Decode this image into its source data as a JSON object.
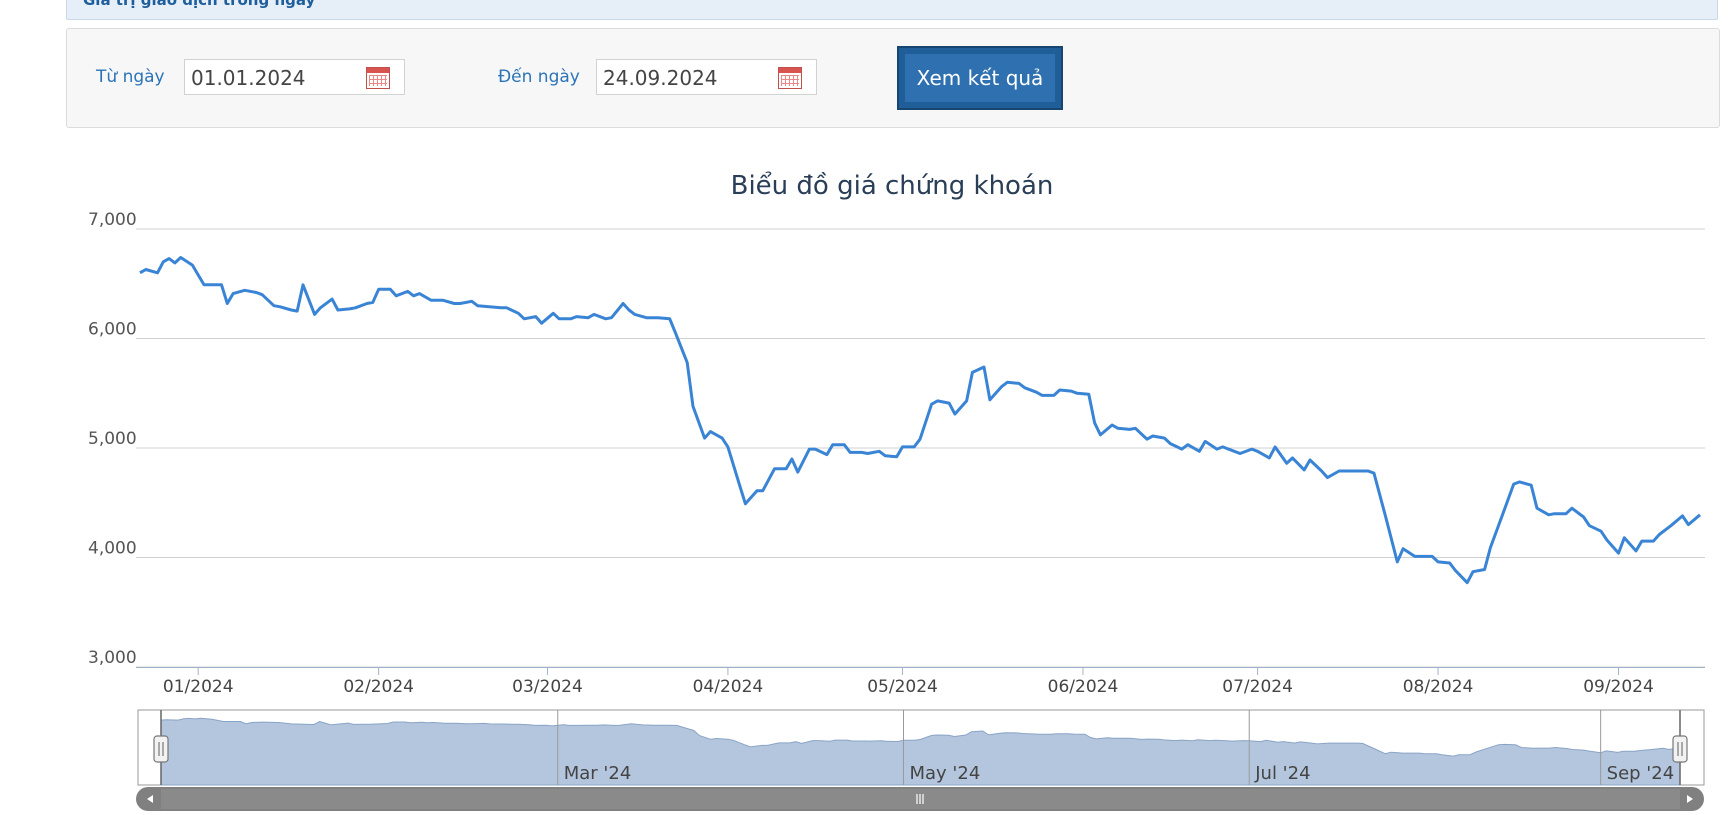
{
  "header": {
    "title": "Giá trị giao dịch trong ngày"
  },
  "filter": {
    "from_label": "Từ ngày",
    "from_value": "01.01.2024",
    "to_label": "Đến ngày",
    "to_value": "24.09.2024",
    "submit_label": "Xem kết quả"
  },
  "colors": {
    "accent": "#2f71b0",
    "line": "#3a84d6",
    "navigator_fill": "#b4c6dd",
    "scrollbar": "#808080"
  },
  "chart_data": {
    "type": "line",
    "title": "Biểu đồ giá chứng khoán",
    "xlabel": "",
    "ylabel": "",
    "ylim": [
      3000,
      7000
    ],
    "yticks": [
      3000,
      4000,
      5000,
      6000,
      7000
    ],
    "ytick_labels": [
      "3,000",
      "4,000",
      "5,000",
      "6,000",
      "7,000"
    ],
    "xticks": [
      {
        "x": "2024-01-01",
        "label": "01/2024"
      },
      {
        "x": "2024-02-01",
        "label": "02/2024"
      },
      {
        "x": "2024-03-01",
        "label": "03/2024"
      },
      {
        "x": "2024-04-01",
        "label": "04/2024"
      },
      {
        "x": "2024-05-01",
        "label": "05/2024"
      },
      {
        "x": "2024-06-01",
        "label": "06/2024"
      },
      {
        "x": "2024-07-01",
        "label": "07/2024"
      },
      {
        "x": "2024-08-01",
        "label": "08/2024"
      },
      {
        "x": "2024-09-01",
        "label": "09/2024"
      }
    ],
    "grid": true,
    "series": [
      {
        "points": [
          [
            "2023-12-22",
            6600
          ],
          [
            "2023-12-23",
            6630
          ],
          [
            "2023-12-25",
            6600
          ],
          [
            "2023-12-26",
            6700
          ],
          [
            "2023-12-27",
            6730
          ],
          [
            "2023-12-28",
            6690
          ],
          [
            "2023-12-29",
            6740
          ],
          [
            "2023-12-31",
            6670
          ],
          [
            "2024-01-02",
            6490
          ],
          [
            "2024-01-03",
            6490
          ],
          [
            "2024-01-05",
            6490
          ],
          [
            "2024-01-06",
            6320
          ],
          [
            "2024-01-07",
            6410
          ],
          [
            "2024-01-09",
            6440
          ],
          [
            "2024-01-11",
            6420
          ],
          [
            "2024-01-12",
            6400
          ],
          [
            "2024-01-14",
            6300
          ],
          [
            "2024-01-15",
            6290
          ],
          [
            "2024-01-17",
            6260
          ],
          [
            "2024-01-18",
            6250
          ],
          [
            "2024-01-19",
            6490
          ],
          [
            "2024-01-21",
            6220
          ],
          [
            "2024-01-22",
            6280
          ],
          [
            "2024-01-24",
            6360
          ],
          [
            "2024-01-25",
            6260
          ],
          [
            "2024-01-27",
            6270
          ],
          [
            "2024-01-28",
            6280
          ],
          [
            "2024-01-30",
            6320
          ],
          [
            "2024-01-31",
            6330
          ],
          [
            "2024-02-01",
            6450
          ],
          [
            "2024-02-03",
            6450
          ],
          [
            "2024-02-04",
            6390
          ],
          [
            "2024-02-06",
            6430
          ],
          [
            "2024-02-07",
            6390
          ],
          [
            "2024-02-08",
            6410
          ],
          [
            "2024-02-10",
            6350
          ],
          [
            "2024-02-12",
            6350
          ],
          [
            "2024-02-14",
            6320
          ],
          [
            "2024-02-15",
            6320
          ],
          [
            "2024-02-17",
            6340
          ],
          [
            "2024-02-18",
            6300
          ],
          [
            "2024-02-20",
            6290
          ],
          [
            "2024-02-22",
            6280
          ],
          [
            "2024-02-23",
            6280
          ],
          [
            "2024-02-25",
            6230
          ],
          [
            "2024-02-26",
            6180
          ],
          [
            "2024-02-28",
            6200
          ],
          [
            "2024-02-29",
            6140
          ],
          [
            "2024-03-02",
            6230
          ],
          [
            "2024-03-03",
            6180
          ],
          [
            "2024-03-05",
            6180
          ],
          [
            "2024-03-06",
            6200
          ],
          [
            "2024-03-08",
            6190
          ],
          [
            "2024-03-09",
            6220
          ],
          [
            "2024-03-11",
            6180
          ],
          [
            "2024-03-12",
            6190
          ],
          [
            "2024-03-14",
            6320
          ],
          [
            "2024-03-15",
            6260
          ],
          [
            "2024-03-16",
            6220
          ],
          [
            "2024-03-18",
            6190
          ],
          [
            "2024-03-20",
            6190
          ],
          [
            "2024-03-22",
            6180
          ],
          [
            "2024-03-23",
            6050
          ],
          [
            "2024-03-25",
            5780
          ],
          [
            "2024-03-26",
            5380
          ],
          [
            "2024-03-28",
            5090
          ],
          [
            "2024-03-29",
            5150
          ],
          [
            "2024-03-31",
            5090
          ],
          [
            "2024-04-01",
            5010
          ],
          [
            "2024-04-03",
            4660
          ],
          [
            "2024-04-04",
            4490
          ],
          [
            "2024-04-06",
            4610
          ],
          [
            "2024-04-07",
            4610
          ],
          [
            "2024-04-09",
            4810
          ],
          [
            "2024-04-11",
            4810
          ],
          [
            "2024-04-12",
            4900
          ],
          [
            "2024-04-13",
            4780
          ],
          [
            "2024-04-15",
            4990
          ],
          [
            "2024-04-16",
            4990
          ],
          [
            "2024-04-18",
            4940
          ],
          [
            "2024-04-19",
            5030
          ],
          [
            "2024-04-21",
            5030
          ],
          [
            "2024-04-22",
            4960
          ],
          [
            "2024-04-24",
            4960
          ],
          [
            "2024-04-25",
            4950
          ],
          [
            "2024-04-27",
            4970
          ],
          [
            "2024-04-28",
            4930
          ],
          [
            "2024-04-30",
            4920
          ],
          [
            "2024-05-01",
            5010
          ],
          [
            "2024-05-03",
            5010
          ],
          [
            "2024-05-04",
            5080
          ],
          [
            "2024-05-06",
            5400
          ],
          [
            "2024-05-07",
            5430
          ],
          [
            "2024-05-09",
            5410
          ],
          [
            "2024-05-10",
            5310
          ],
          [
            "2024-05-12",
            5430
          ],
          [
            "2024-05-13",
            5690
          ],
          [
            "2024-05-15",
            5740
          ],
          [
            "2024-05-16",
            5440
          ],
          [
            "2024-05-18",
            5560
          ],
          [
            "2024-05-19",
            5600
          ],
          [
            "2024-05-21",
            5590
          ],
          [
            "2024-05-22",
            5550
          ],
          [
            "2024-05-24",
            5510
          ],
          [
            "2024-05-25",
            5480
          ],
          [
            "2024-05-27",
            5480
          ],
          [
            "2024-05-28",
            5530
          ],
          [
            "2024-05-30",
            5520
          ],
          [
            "2024-05-31",
            5500
          ],
          [
            "2024-06-02",
            5490
          ],
          [
            "2024-06-03",
            5230
          ],
          [
            "2024-06-04",
            5120
          ],
          [
            "2024-06-06",
            5210
          ],
          [
            "2024-06-07",
            5180
          ],
          [
            "2024-06-09",
            5170
          ],
          [
            "2024-06-10",
            5180
          ],
          [
            "2024-06-12",
            5080
          ],
          [
            "2024-06-13",
            5110
          ],
          [
            "2024-06-15",
            5090
          ],
          [
            "2024-06-16",
            5040
          ],
          [
            "2024-06-18",
            4990
          ],
          [
            "2024-06-19",
            5030
          ],
          [
            "2024-06-21",
            4970
          ],
          [
            "2024-06-22",
            5060
          ],
          [
            "2024-06-24",
            4990
          ],
          [
            "2024-06-25",
            5010
          ],
          [
            "2024-06-27",
            4970
          ],
          [
            "2024-06-28",
            4950
          ],
          [
            "2024-06-30",
            4990
          ],
          [
            "2024-07-01",
            4970
          ],
          [
            "2024-07-03",
            4910
          ],
          [
            "2024-07-04",
            5010
          ],
          [
            "2024-07-06",
            4860
          ],
          [
            "2024-07-07",
            4910
          ],
          [
            "2024-07-09",
            4800
          ],
          [
            "2024-07-10",
            4890
          ],
          [
            "2024-07-12",
            4790
          ],
          [
            "2024-07-13",
            4730
          ],
          [
            "2024-07-15",
            4790
          ],
          [
            "2024-07-16",
            4790
          ],
          [
            "2024-07-18",
            4790
          ],
          [
            "2024-07-20",
            4790
          ],
          [
            "2024-07-21",
            4770
          ],
          [
            "2024-07-23",
            4370
          ],
          [
            "2024-07-25",
            3960
          ],
          [
            "2024-07-26",
            4080
          ],
          [
            "2024-07-28",
            4010
          ],
          [
            "2024-07-29",
            4010
          ],
          [
            "2024-07-31",
            4010
          ],
          [
            "2024-08-01",
            3960
          ],
          [
            "2024-08-03",
            3950
          ],
          [
            "2024-08-04",
            3880
          ],
          [
            "2024-08-06",
            3770
          ],
          [
            "2024-08-07",
            3870
          ],
          [
            "2024-08-09",
            3890
          ],
          [
            "2024-08-10",
            4090
          ],
          [
            "2024-08-12",
            4380
          ],
          [
            "2024-08-14",
            4670
          ],
          [
            "2024-08-15",
            4690
          ],
          [
            "2024-08-17",
            4660
          ],
          [
            "2024-08-18",
            4450
          ],
          [
            "2024-08-20",
            4390
          ],
          [
            "2024-08-21",
            4400
          ],
          [
            "2024-08-23",
            4400
          ],
          [
            "2024-08-24",
            4450
          ],
          [
            "2024-08-26",
            4370
          ],
          [
            "2024-08-27",
            4290
          ],
          [
            "2024-08-29",
            4240
          ],
          [
            "2024-08-30",
            4160
          ],
          [
            "2024-09-01",
            4040
          ],
          [
            "2024-09-02",
            4180
          ],
          [
            "2024-09-04",
            4060
          ],
          [
            "2024-09-05",
            4150
          ],
          [
            "2024-09-07",
            4150
          ],
          [
            "2024-09-08",
            4210
          ],
          [
            "2024-09-10",
            4290
          ],
          [
            "2024-09-12",
            4380
          ],
          [
            "2024-09-13",
            4300
          ],
          [
            "2024-09-15",
            4390
          ]
        ]
      }
    ],
    "navigator": {
      "ticks": [
        {
          "x": "2024-03-01",
          "label": "Mar '24"
        },
        {
          "x": "2024-05-01",
          "label": "May '24"
        },
        {
          "x": "2024-07-01",
          "label": "Jul '24"
        },
        {
          "x": "2024-09-01",
          "label": "Sep '24"
        }
      ]
    }
  }
}
